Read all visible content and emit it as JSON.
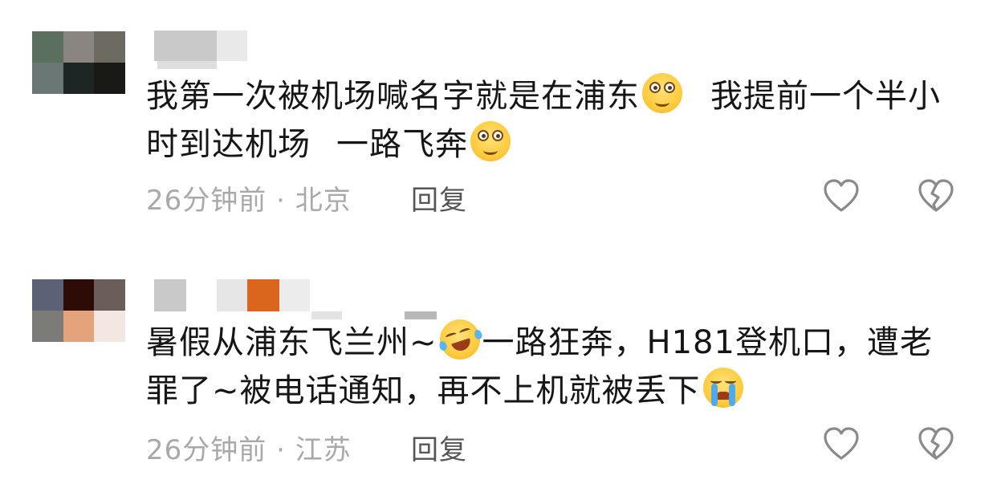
{
  "comments": [
    {
      "text_parts": [
        "我第一次被机场喊名字就是在浦东",
        "我提前一个半小时到达机场",
        "一路飞奔"
      ],
      "emojis": [
        "dizzy-smile",
        "dizzy-smile"
      ],
      "time": "26分钟前",
      "separator": "·",
      "location": "北京",
      "reply_label": "回复",
      "avatar_colors": [
        "#5b6f5e",
        "#8b8582",
        "#6d6a62",
        "#6a7774",
        "#1e2625",
        "#191a17"
      ],
      "name_colors": [
        "#c9c9c9",
        "#e9e9e9",
        "#dedede"
      ]
    },
    {
      "text_parts": [
        "暑假从浦东飞兰州~",
        "一路狂奔，H181登机口，遭老罪了~被电话通知，再不上机就被丢下"
      ],
      "emojis": [
        "laughing-crying",
        "loudly-crying"
      ],
      "time": "26分钟前",
      "separator": "·",
      "location": "江苏",
      "reply_label": "回复",
      "avatar_colors": [
        "#5b6276",
        "#2d0c08",
        "#6b5e59",
        "#7b7b77",
        "#e5a37b",
        "#f2e8e1"
      ],
      "name_colors": [
        "#c9c9c9",
        "#e6e6e6",
        "#d9661c",
        "#ececec",
        "#b8b8b8"
      ]
    }
  ],
  "icons": {
    "like": "heart-outline-icon",
    "dislike": "broken-heart-icon"
  },
  "colors": {
    "text": "#161616",
    "meta": "#a9a9a9",
    "reply": "#555555",
    "icon": "#8a8a8a"
  }
}
